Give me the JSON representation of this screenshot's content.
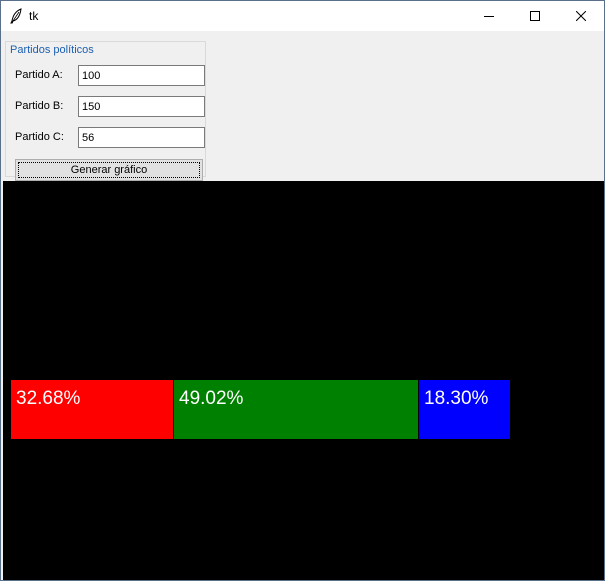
{
  "window": {
    "title": "tk",
    "controls": [
      "minimize",
      "maximize",
      "close"
    ]
  },
  "form": {
    "group_title": "Partidos políticos",
    "fields": [
      {
        "label": "Partido A:",
        "value": "100"
      },
      {
        "label": "Partido B:",
        "value": "150"
      },
      {
        "label": "Partido C:",
        "value": "56"
      }
    ],
    "button_label": "Generar gráfico"
  },
  "chart_data": {
    "type": "bar",
    "orientation": "horizontal-stacked",
    "categories": [
      "Partido A",
      "Partido B",
      "Partido C"
    ],
    "values": [
      100,
      150,
      56
    ],
    "percent_labels": [
      "32.68%",
      "49.02%",
      "18.30%"
    ],
    "percent_values": [
      32.68,
      49.02,
      18.3
    ],
    "colors": [
      "#ff0000",
      "#008000",
      "#0000ff"
    ],
    "background": "#000000"
  }
}
